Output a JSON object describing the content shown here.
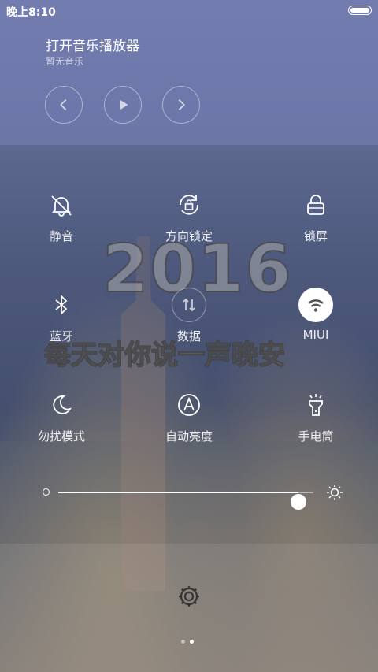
{
  "status": {
    "time": "晚上8:10",
    "battery_icon": "battery-full-icon"
  },
  "music": {
    "title": "打开音乐播放器",
    "subtitle": "暂无音乐",
    "controls": [
      "prev-icon",
      "play-icon",
      "next-icon"
    ]
  },
  "toggles": [
    {
      "label": "静音",
      "icon": "bell-muted-icon",
      "on": false
    },
    {
      "label": "方向锁定",
      "icon": "rotation-lock-icon",
      "on": false
    },
    {
      "label": "锁屏",
      "icon": "lock-icon",
      "on": false
    },
    {
      "label": "蓝牙",
      "icon": "bluetooth-icon",
      "on": false
    },
    {
      "label": "数据",
      "icon": "data-icon",
      "on": false
    },
    {
      "label": "MIUI",
      "icon": "wifi-icon",
      "on": true
    },
    {
      "label": "勿扰模式",
      "icon": "moon-icon",
      "on": false
    },
    {
      "label": "自动亮度",
      "icon": "auto-brightness-icon",
      "on": false
    },
    {
      "label": "手电筒",
      "icon": "flashlight-icon",
      "on": false
    }
  ],
  "wallpaper": {
    "year": "2016",
    "caption": "每天对你说一声晚安"
  },
  "brightness": {
    "level": 0.94
  },
  "pager": {
    "pages": 2,
    "current": 1
  }
}
